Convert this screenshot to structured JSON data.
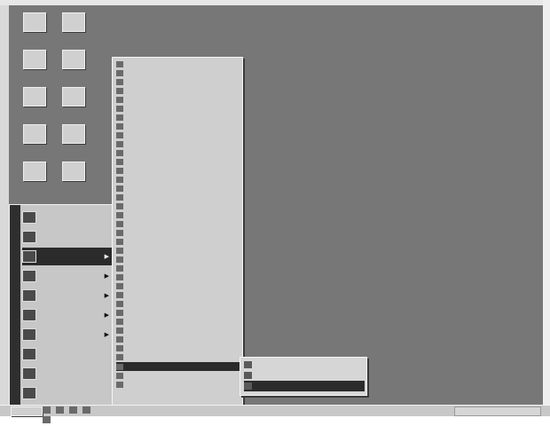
{
  "colors": {
    "desktop": "#777777",
    "menu_bg": "#cfcfcf",
    "selection": "#2b2b2b",
    "selection_text": "#eaeaea"
  },
  "desktop_icons": [
    {
      "name": "my-computer-icon",
      "label": ""
    },
    {
      "name": "my-documents-icon",
      "label": ""
    },
    {
      "name": "network-icon",
      "label": ""
    },
    {
      "name": "recycle-bin-icon",
      "label": ""
    },
    {
      "name": "internet-icon",
      "label": ""
    },
    {
      "name": "outlook-icon",
      "label": ""
    },
    {
      "name": "app-icon-1",
      "label": ""
    },
    {
      "name": "app-icon-2",
      "label": ""
    },
    {
      "name": "app-icon-3",
      "label": ""
    },
    {
      "name": "app-icon-4",
      "label": ""
    }
  ],
  "start_menu": {
    "items": [
      {
        "label": "",
        "has_arrow": false
      },
      {
        "label": "",
        "has_arrow": false
      },
      {
        "label": "",
        "has_arrow": true,
        "selected": true
      },
      {
        "label": "",
        "has_arrow": true
      },
      {
        "label": "",
        "has_arrow": true
      },
      {
        "label": "",
        "has_arrow": true
      },
      {
        "label": "",
        "has_arrow": true
      },
      {
        "label": "",
        "has_arrow": false
      },
      {
        "label": "",
        "has_arrow": false
      },
      {
        "label": "",
        "has_arrow": false
      }
    ]
  },
  "programs_menu": {
    "items": [
      {
        "label": ""
      },
      {
        "label": ""
      },
      {
        "label": ""
      },
      {
        "label": ""
      },
      {
        "label": ""
      },
      {
        "label": ""
      },
      {
        "label": ""
      },
      {
        "label": ""
      },
      {
        "label": ""
      },
      {
        "label": ""
      },
      {
        "label": ""
      },
      {
        "label": ""
      },
      {
        "label": ""
      },
      {
        "label": ""
      },
      {
        "label": ""
      },
      {
        "label": ""
      },
      {
        "label": ""
      },
      {
        "label": ""
      },
      {
        "label": ""
      },
      {
        "label": ""
      },
      {
        "label": ""
      },
      {
        "label": ""
      },
      {
        "label": ""
      },
      {
        "label": ""
      },
      {
        "label": ""
      },
      {
        "label": ""
      },
      {
        "label": ""
      },
      {
        "label": ""
      },
      {
        "label": ""
      },
      {
        "label": ""
      },
      {
        "label": ""
      },
      {
        "label": ""
      },
      {
        "label": ""
      },
      {
        "label": ""
      },
      {
        "label": ""
      },
      {
        "label": "",
        "selected": true
      },
      {
        "label": ""
      },
      {
        "label": ""
      }
    ]
  },
  "accessories_menu": {
    "items": [
      {
        "label": ""
      },
      {
        "label": ""
      },
      {
        "label": "",
        "selected": true
      }
    ]
  },
  "taskbar": {
    "start_label": "",
    "quick_launch": [
      "ie-icon",
      "outlook-icon",
      "desktop-icon",
      "folder-icon",
      "media-icon"
    ],
    "clock": ""
  }
}
